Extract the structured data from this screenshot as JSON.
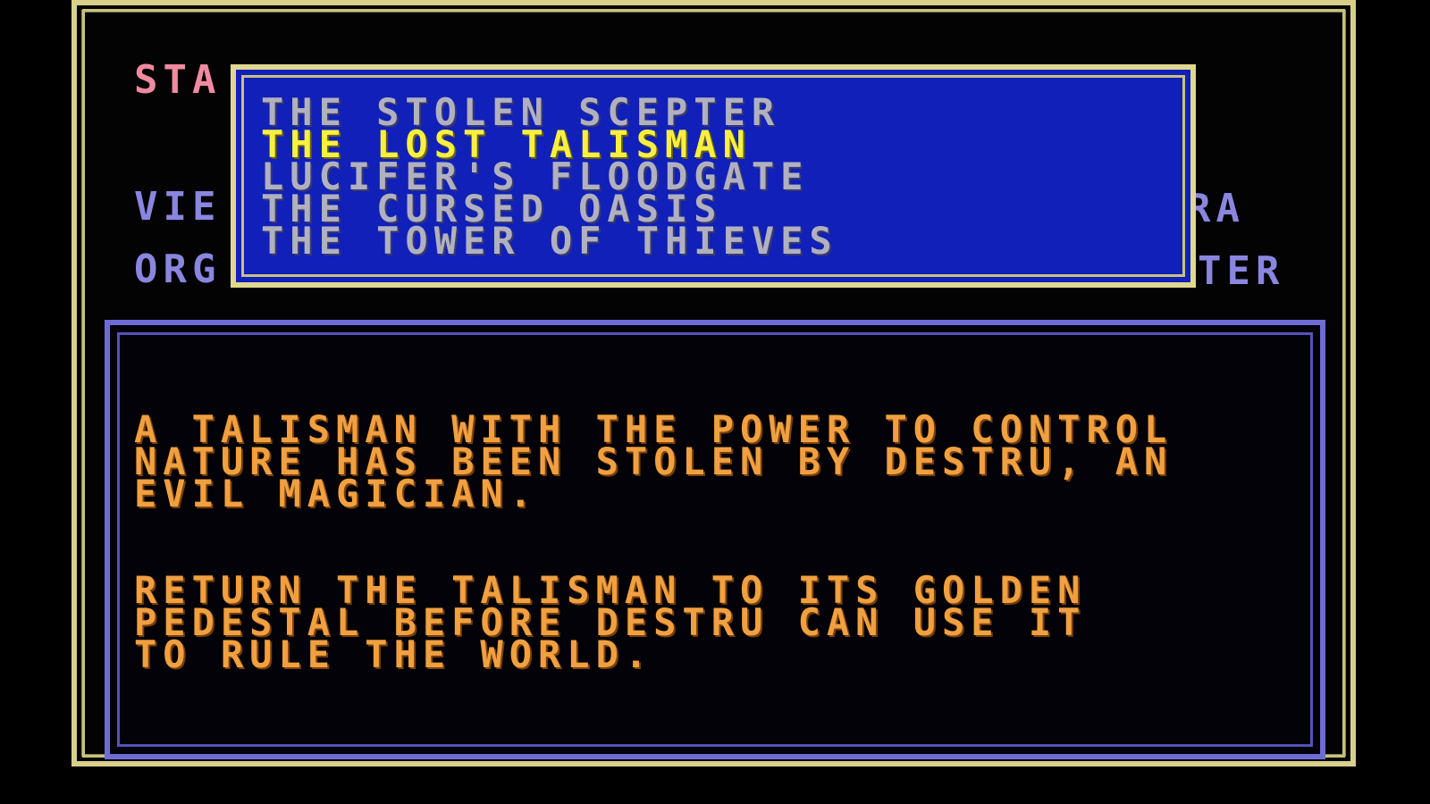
{
  "menu": {
    "start_label": "STA",
    "view_label": "VIE",
    "org_label": "ORG",
    "right_label_1": "RA",
    "right_label_2": "TER"
  },
  "scenarios": [
    {
      "label": "THE STOLEN SCEPTER",
      "selected": false
    },
    {
      "label": "THE LOST TALISMAN",
      "selected": true
    },
    {
      "label": "LUCIFER'S FLOODGATE",
      "selected": false
    },
    {
      "label": "THE CURSED OASIS",
      "selected": false
    },
    {
      "label": "THE TOWER OF THIEVES",
      "selected": false
    }
  ],
  "description": {
    "paragraph_1": "A TALISMAN WITH THE POWER TO CONTROL\nNATURE HAS BEEN STOLEN BY DESTRU, AN\nEVIL MAGICIAN.",
    "paragraph_2": "RETURN THE TALISMAN TO ITS GOLDEN\nPEDESTAL BEFORE DESTRU CAN USE IT\nTO RULE THE WORLD."
  },
  "colors": {
    "selected_text": "#f8f040",
    "unselected_text": "#b0b0c0",
    "description_text": "#f0a040",
    "popup_background": "#1020b8",
    "frame": "#d8d08a",
    "panel_border": "#6f6bd6"
  }
}
